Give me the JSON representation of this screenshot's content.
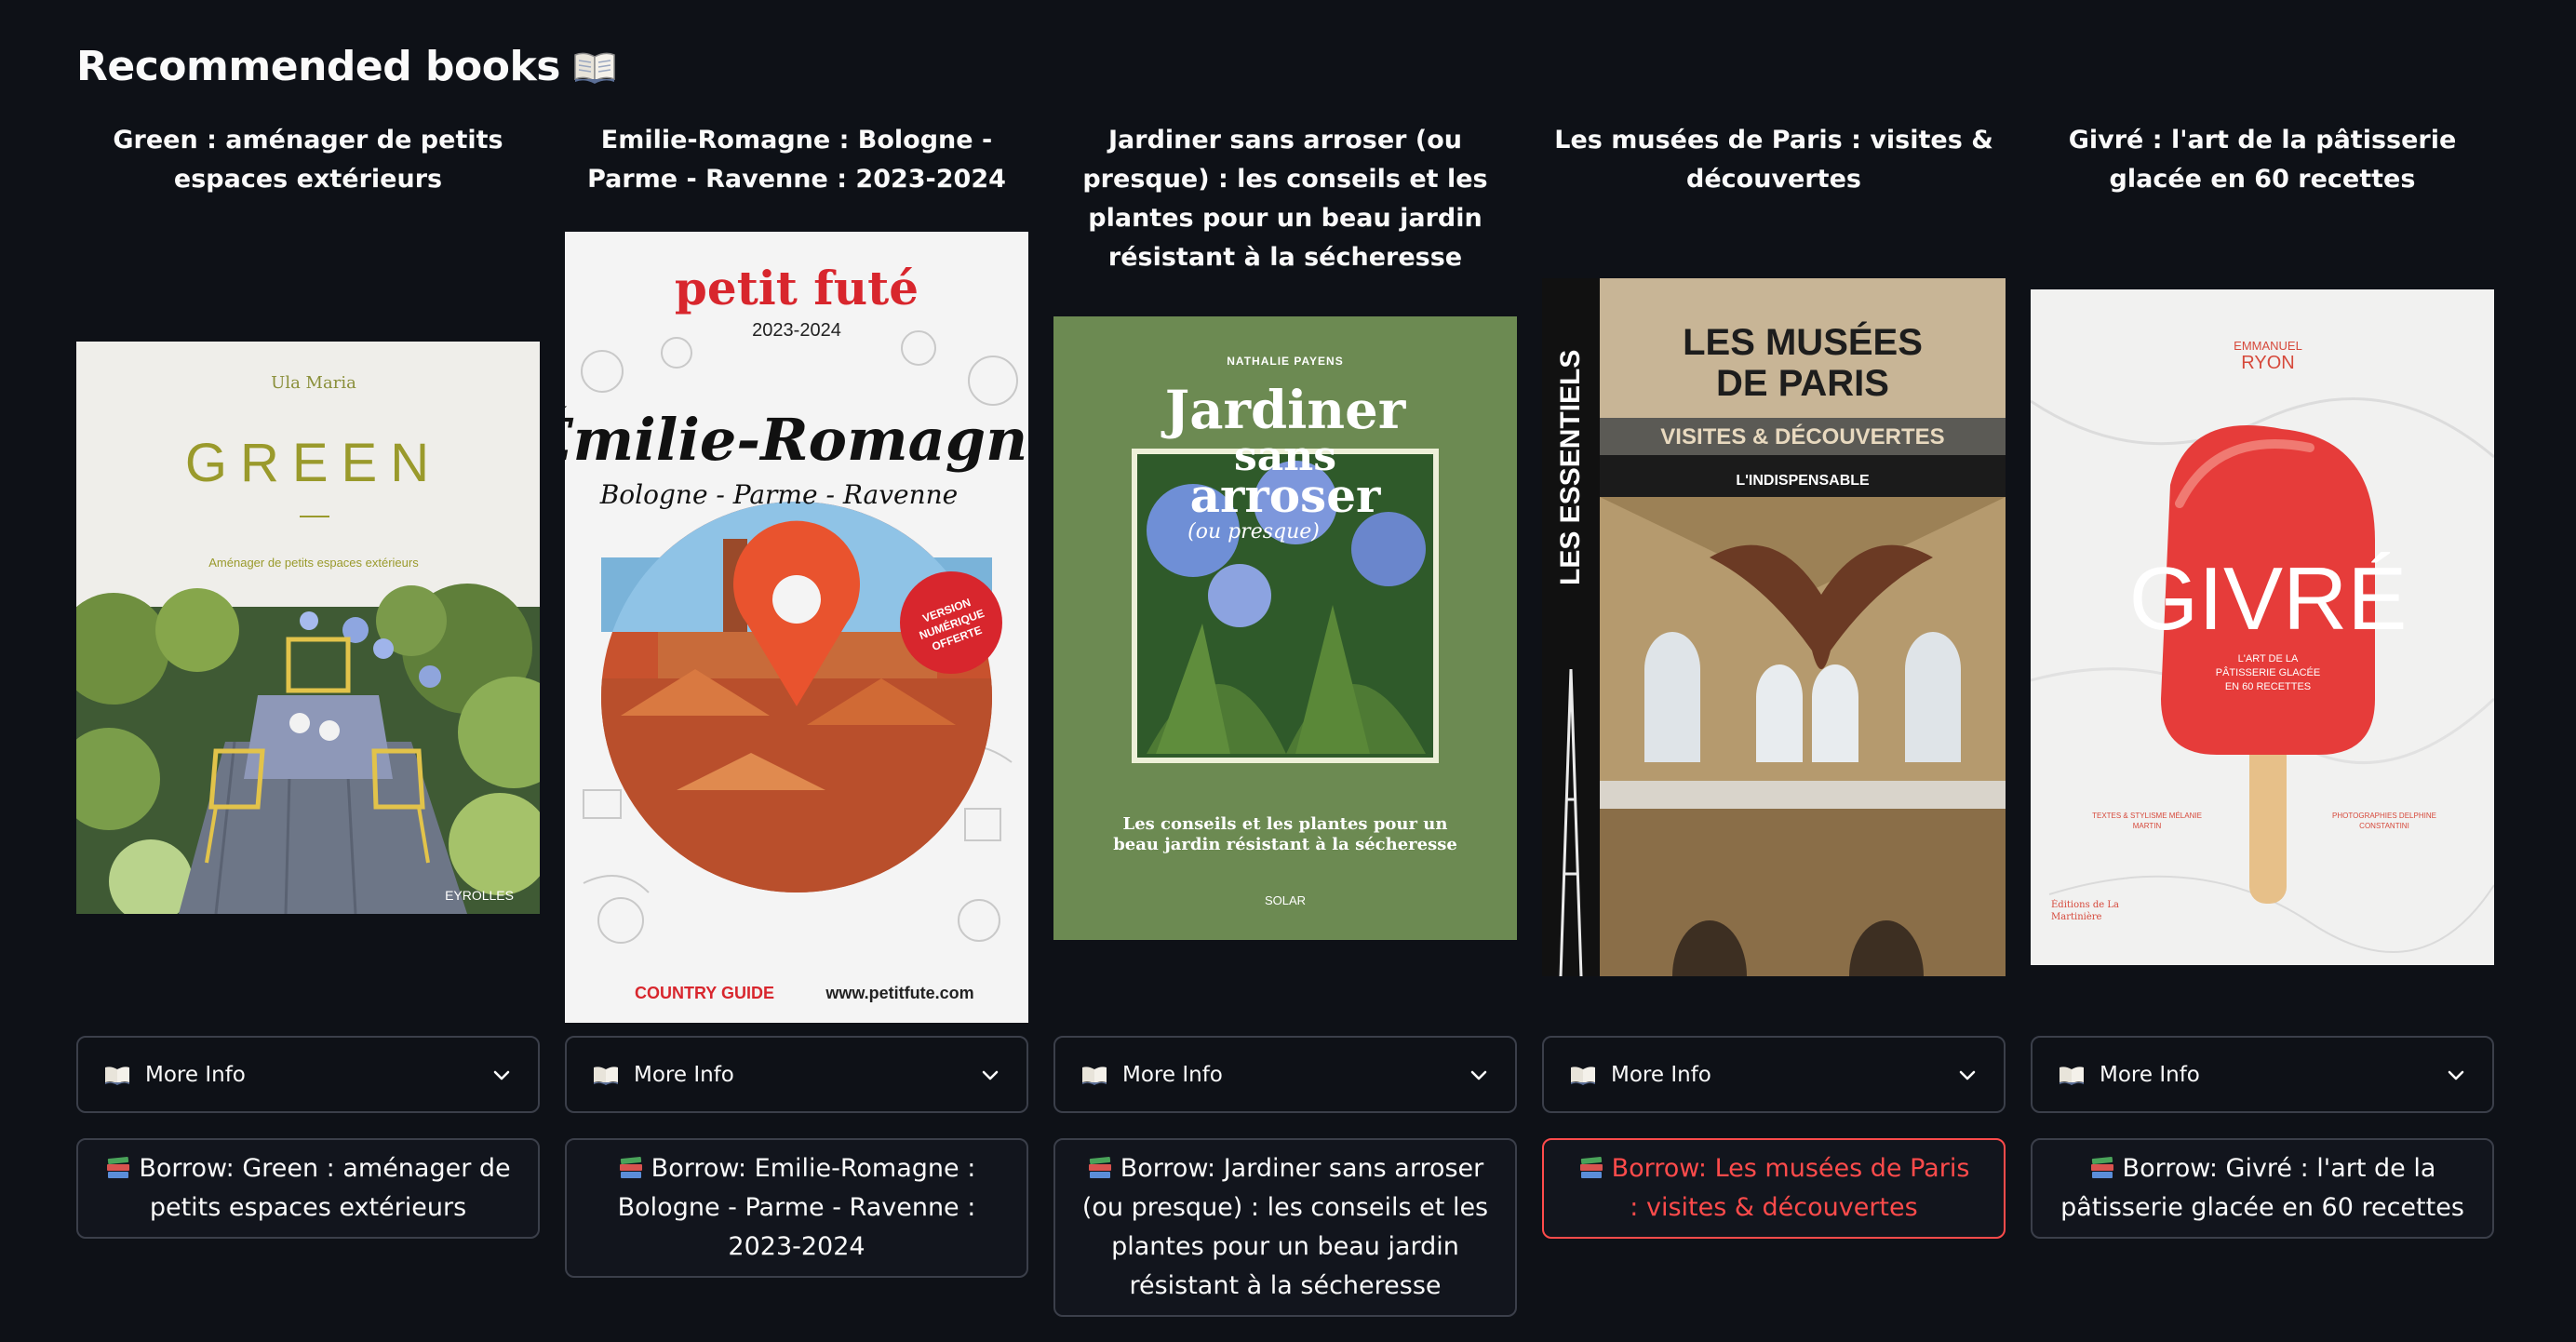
{
  "page": {
    "title": "Recommended books"
  },
  "books": [
    {
      "title": "Green : aménager de petits espaces extérieurs",
      "cover": {
        "author": "Ula Maria",
        "main": "GREEN",
        "subtitle": "Aménager de petits espaces extérieurs",
        "publisher": "EYROLLES"
      },
      "more_info": "More Info",
      "borrow": "Borrow: Green : aménager de petits espaces extérieurs"
    },
    {
      "title": "Emilie-Romagne : Bologne - Parme - Ravenne : 2023-2024",
      "cover": {
        "brand": "petit futé",
        "year": "2023-2024",
        "main": "Émilie-Romagne",
        "sub": "Bologne - Parme - Ravenne",
        "badge": "VERSION NUMÉRIQUE OFFERTE",
        "footer_left": "COUNTRY GUIDE",
        "footer_right": "www.petitfute.com"
      },
      "more_info": "More Info",
      "borrow": "Borrow: Emilie-Romagne : Bologne - Parme - Ravenne : 2023-2024"
    },
    {
      "title": "Jardiner sans arroser (ou presque) : les conseils et les plantes pour un beau jardin résistant à la sécheresse",
      "cover": {
        "author": "NATHALIE PAYENS",
        "line1": "Jardiner",
        "line2": "sans",
        "line3": "arroser",
        "line4": "(ou presque)",
        "tagline": "Les conseils et les plantes pour un beau jardin résistant à la sécheresse",
        "publisher": "SOLAR"
      },
      "more_info": "More Info",
      "borrow": "Borrow: Jardiner sans arroser (ou presque) : les conseils et les plantes pour un beau jardin résistant à la sécheresse"
    },
    {
      "title": "Les musées de Paris : visites & découvertes",
      "cover": {
        "series": "LES ESSENTIELS",
        "line1": "LES MUSÉES",
        "line2": "DE PARIS",
        "sub": "VISITES & DÉCOUVERTES",
        "tag": "L'INDISPENSABLE"
      },
      "more_info": "More Info",
      "borrow": "Borrow: Les musées de Paris : visites & découvertes"
    },
    {
      "title": "Givré : l'art de la pâtisserie glacée en 60 recettes",
      "cover": {
        "author1": "EMMANUEL",
        "author2": "RYON",
        "main": "GIVRÉ",
        "sub1": "L'ART DE LA",
        "sub2": "PÂTISSERIE GLACÉE",
        "sub3": "EN 60 RECETTES",
        "credit_left": "TEXTES & STYLISME MÉLANIE MARTIN",
        "credit_right": "PHOTOGRAPHIES DELPHINE CONSTANTINI",
        "publisher": "Éditions de La Martinière"
      },
      "more_info": "More Info",
      "borrow": "Borrow: Givré : l'art de la pâtisserie glacée en 60 recettes"
    }
  ],
  "colors": {
    "background": "#0e1117",
    "border": "#3b3f4a",
    "accent_hover": "#ff4b4b"
  },
  "icons": {
    "title": "open-book-icon",
    "expander": "open-book-icon",
    "chevron": "chevron-down-icon",
    "borrow": "books-stack-icon"
  }
}
